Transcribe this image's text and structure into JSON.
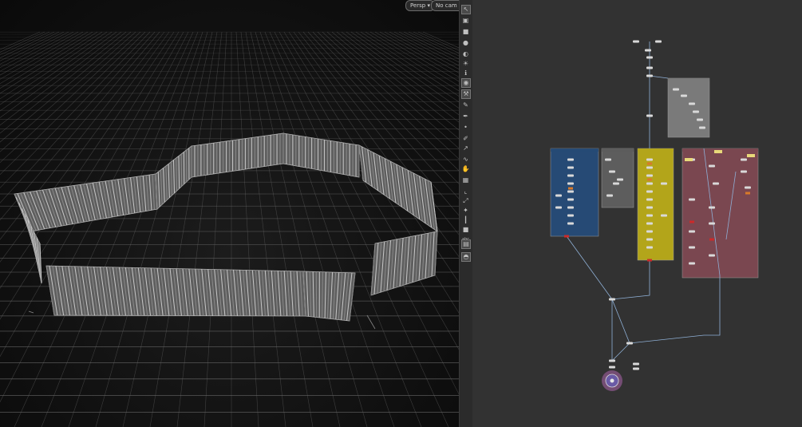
{
  "viewport": {
    "persp_menu": "Persp ▾",
    "cam_menu": "No cam ▾"
  },
  "toolbar": {
    "icons": [
      {
        "name": "select-icon",
        "glyph": "↖",
        "active": true
      },
      {
        "name": "view-icon",
        "glyph": "▣"
      },
      {
        "name": "lock-icon",
        "glyph": "■"
      },
      {
        "name": "camera-icon",
        "glyph": "●"
      },
      {
        "name": "shading-icon",
        "glyph": "◐"
      },
      {
        "name": "light-icon",
        "glyph": "☀"
      },
      {
        "name": "info-icon",
        "glyph": "ℹ"
      },
      {
        "name": "snap-icon",
        "glyph": "◉",
        "active": true
      },
      {
        "name": "handle-icon",
        "glyph": "⚒",
        "active": true
      },
      {
        "name": "paint-icon",
        "glyph": "✎"
      },
      {
        "name": "brush-icon",
        "glyph": "✒"
      },
      {
        "name": "point-icon",
        "glyph": "•"
      },
      {
        "name": "pen-icon",
        "glyph": "✐"
      },
      {
        "name": "vector-icon",
        "glyph": "↗"
      },
      {
        "name": "curve-icon",
        "glyph": "∿"
      },
      {
        "name": "hand-icon",
        "glyph": "✋"
      },
      {
        "name": "grid-icon",
        "glyph": "▦"
      },
      {
        "name": "measure-icon",
        "glyph": "⌞"
      },
      {
        "name": "scale-icon",
        "glyph": "⤢"
      },
      {
        "name": "node-icon",
        "glyph": "✦"
      },
      {
        "name": "guide-icon",
        "glyph": "┃"
      },
      {
        "name": "square-icon",
        "glyph": "■"
      },
      {
        "name": "text-icon",
        "glyph": "abc"
      },
      {
        "name": "display-icon",
        "glyph": "▤",
        "active": true
      },
      {
        "name": "render-icon",
        "glyph": "◓",
        "active": true
      }
    ]
  },
  "network": {
    "boxes": [
      {
        "name": "network-box-blue",
        "color": "#264a75"
      },
      {
        "name": "network-box-gray-small",
        "color": "#5d5d5d"
      },
      {
        "name": "network-box-yellow",
        "color": "#b3a51a"
      },
      {
        "name": "network-box-gray-top",
        "color": "#7a7a7a"
      },
      {
        "name": "network-box-red",
        "color": "#7a4750"
      }
    ]
  },
  "colors": {
    "grid": "#6a6a6a",
    "fence": "#9a9a9a",
    "wire": "#8fb0d6",
    "node": "#d9d9d9"
  }
}
